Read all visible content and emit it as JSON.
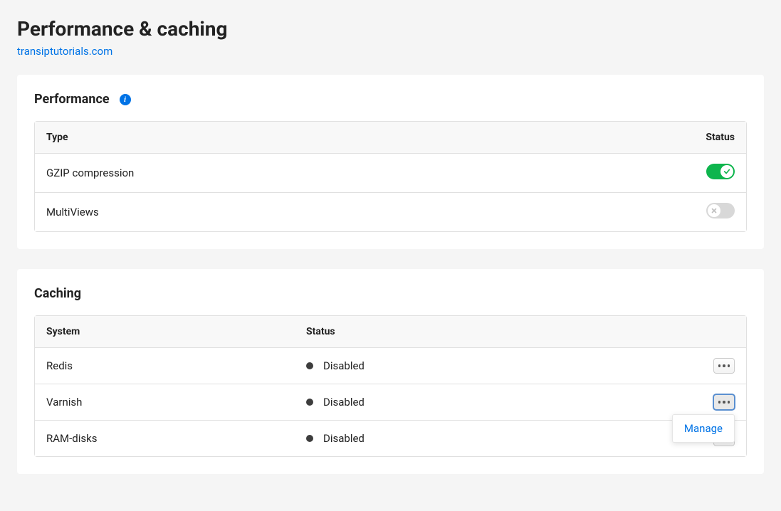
{
  "page_title": "Performance & caching",
  "breadcrumb": "transiptutorials.com",
  "performance": {
    "title": "Performance",
    "headers": {
      "type": "Type",
      "status": "Status"
    },
    "rows": [
      {
        "name": "GZIP compression",
        "enabled": true
      },
      {
        "name": "MultiViews",
        "enabled": false
      }
    ]
  },
  "caching": {
    "title": "Caching",
    "headers": {
      "system": "System",
      "status": "Status"
    },
    "rows": [
      {
        "name": "Redis",
        "status": "Disabled",
        "menu_open": false
      },
      {
        "name": "Varnish",
        "status": "Disabled",
        "menu_open": true
      },
      {
        "name": "RAM-disks",
        "status": "Disabled",
        "menu_open": false
      }
    ],
    "menu": {
      "manage": "Manage"
    }
  }
}
